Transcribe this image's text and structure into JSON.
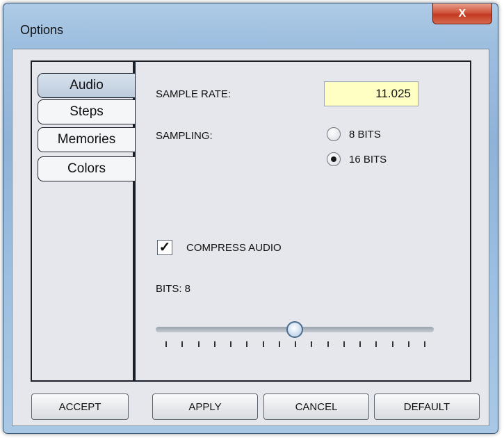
{
  "window": {
    "title": "Options",
    "close_label": "X"
  },
  "tabs": [
    {
      "label": "Audio",
      "active": true
    },
    {
      "label": "Steps",
      "active": false
    },
    {
      "label": "Memories",
      "active": false
    },
    {
      "label": "Colors",
      "active": false
    }
  ],
  "audio": {
    "sample_rate_label": "SAMPLE RATE:",
    "sample_rate_value": "11.025",
    "sampling_label": "SAMPLING:",
    "sampling_options": [
      {
        "label": "8 BITS",
        "selected": false
      },
      {
        "label": "16 BITS",
        "selected": true
      }
    ],
    "compress_label": "COMPRESS AUDIO",
    "compress_checked": true,
    "check_glyph": "✓",
    "bits_label": "BITS: 8",
    "slider": {
      "min": 0,
      "max": 16,
      "value": 8
    }
  },
  "buttons": {
    "accept": "ACCEPT",
    "apply": "APPLY",
    "cancel": "CANCEL",
    "default": "DEFAULT"
  }
}
